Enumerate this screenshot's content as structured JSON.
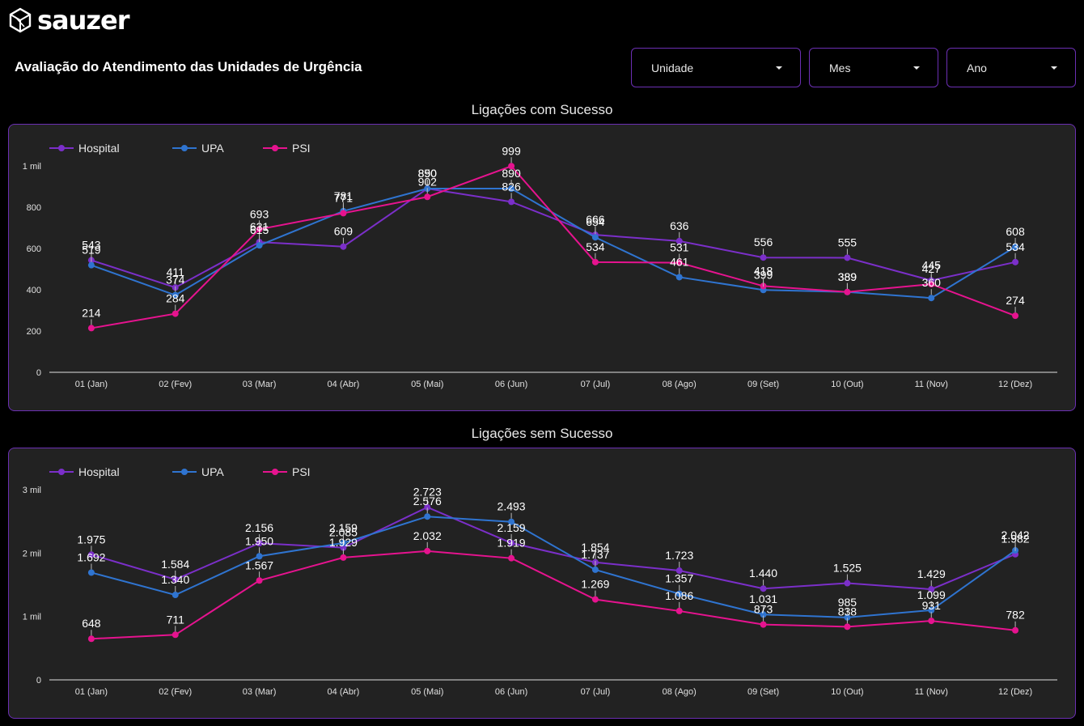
{
  "header": {
    "logo_text": "sauzer",
    "title": "Avaliação do Atendimento das Unidades de Urgência"
  },
  "filters": {
    "unidade": "Unidade",
    "mes": "Mes",
    "ano": "Ano"
  },
  "colors": {
    "Hospital": "#7b2fc9",
    "UPA": "#2f74d0",
    "PSI": "#e6138f",
    "panel_border": "#6b2fb3",
    "panel_bg": "#222222"
  },
  "chart_data": [
    {
      "type": "line",
      "title": "Ligações com Sucesso",
      "categories": [
        "01 (Jan)",
        "02 (Fev)",
        "03 (Mar)",
        "04 (Abr)",
        "05 (Mai)",
        "06 (Jun)",
        "07 (Jul)",
        "08 (Ago)",
        "09 (Set)",
        "10 (Out)",
        "11 (Nov)",
        "12 (Dez)"
      ],
      "ylim": [
        0,
        1000
      ],
      "yticks": [
        0,
        200,
        400,
        600,
        800,
        1000
      ],
      "ytick_labels": [
        "0",
        "200",
        "400",
        "600",
        "800",
        "1 mil"
      ],
      "legend": "top-left",
      "grid": false,
      "series": [
        {
          "name": "Hospital",
          "values": [
            543,
            411,
            631,
            609,
            890,
            826,
            666,
            636,
            556,
            555,
            445,
            534
          ],
          "labels": [
            "543",
            "411",
            "631",
            "609",
            "890",
            "826",
            "666",
            "636",
            "556",
            "555",
            "445",
            "534"
          ]
        },
        {
          "name": "UPA",
          "values": [
            519,
            374,
            615,
            781,
            890,
            890,
            654,
            461,
            399,
            389,
            360,
            608
          ],
          "labels": [
            "519",
            "374",
            "615",
            "781",
            "850",
            "890",
            "654",
            "461",
            "399",
            "389",
            "360",
            "608"
          ]
        },
        {
          "name": "PSI",
          "values": [
            214,
            284,
            693,
            771,
            850,
            999,
            534,
            531,
            418,
            389,
            427,
            274
          ],
          "labels": [
            "214",
            "284",
            "693",
            "771",
            "902",
            "999",
            "534",
            "531",
            "418",
            "389",
            "427",
            "274"
          ]
        }
      ]
    },
    {
      "type": "line",
      "title": "Ligações sem Sucesso",
      "categories": [
        "01 (Jan)",
        "02 (Fev)",
        "03 (Mar)",
        "04 (Abr)",
        "05 (Mai)",
        "06 (Jun)",
        "07 (Jul)",
        "08 (Ago)",
        "09 (Set)",
        "10 (Out)",
        "11 (Nov)",
        "12 (Dez)"
      ],
      "ylim": [
        0,
        3000
      ],
      "yticks": [
        0,
        1000,
        2000,
        3000
      ],
      "ytick_labels": [
        "0",
        "1 mil",
        "2 mil",
        "3 mil"
      ],
      "legend": "top-left",
      "grid": false,
      "series": [
        {
          "name": "Hospital",
          "values": [
            1975,
            1584,
            2156,
            2085,
            2723,
            2159,
            1854,
            1723,
            1440,
            1525,
            1429,
            1982
          ],
          "labels": [
            "1.975",
            "1.584",
            "2.156",
            "2.085",
            "2.723",
            "2.159",
            "1.854",
            "1.723",
            "1.440",
            "1.525",
            "1.429",
            "1.982"
          ]
        },
        {
          "name": "UPA",
          "values": [
            1692,
            1340,
            1950,
            2159,
            2576,
            2493,
            1737,
            1357,
            1031,
            985,
            1099,
            2042
          ],
          "labels": [
            "1.692",
            "1.340",
            "1.950",
            "2.159",
            "2.576",
            "2.493",
            "1.737",
            "1.357",
            "1.031",
            "985",
            "1.099",
            "2.042"
          ]
        },
        {
          "name": "PSI",
          "values": [
            648,
            711,
            1567,
            1929,
            2032,
            1919,
            1269,
            1086,
            873,
            838,
            931,
            782
          ],
          "labels": [
            "648",
            "711",
            "1.567",
            "1.929",
            "2.032",
            "1.919",
            "1.269",
            "1.086",
            "873",
            "838",
            "931",
            "782"
          ]
        }
      ]
    }
  ]
}
